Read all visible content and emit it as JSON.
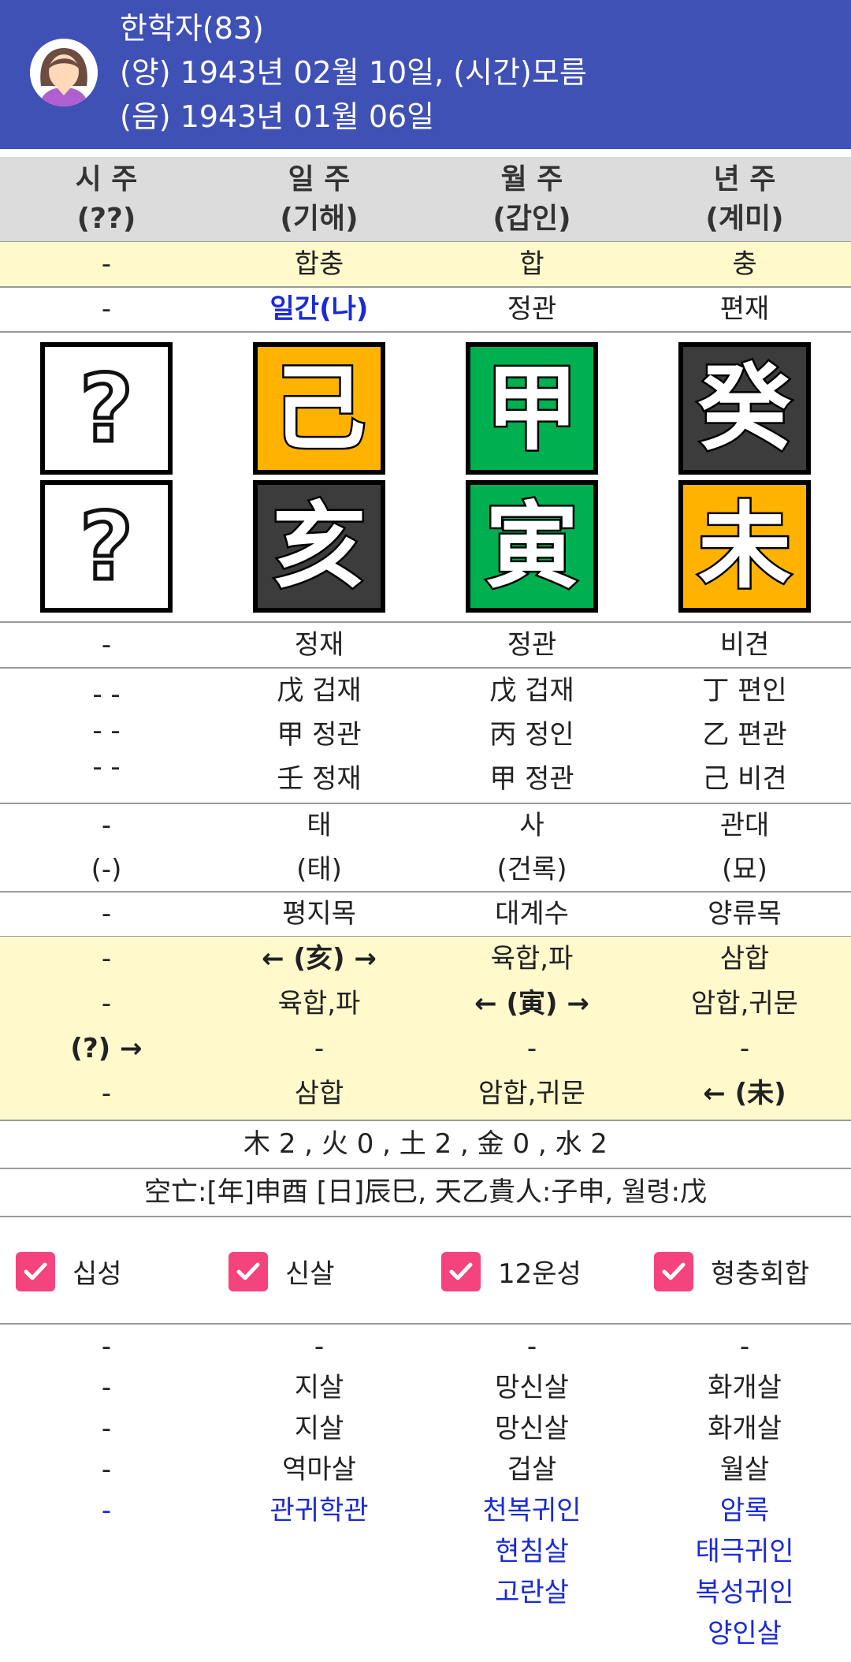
{
  "profile": {
    "name": "한학자(83)",
    "solar": "(양) 1943년 02월 10일, (시간)모름",
    "lunar": "(음) 1943년 01월 06일"
  },
  "pillars": [
    {
      "label": "시 주",
      "ganji": "(??)"
    },
    {
      "label": "일 주",
      "ganji": "(기해)"
    },
    {
      "label": "월 주",
      "ganji": "(갑인)"
    },
    {
      "label": "년 주",
      "ganji": "(계미)"
    }
  ],
  "relations": [
    "-",
    "합충",
    "합",
    "충"
  ],
  "stem_sipsung": [
    "-",
    "일간(나)",
    "정관",
    "편재"
  ],
  "stems": [
    {
      "char": "?",
      "color": "white"
    },
    {
      "char": "己",
      "color": "yellow"
    },
    {
      "char": "甲",
      "color": "green"
    },
    {
      "char": "癸",
      "color": "dark"
    }
  ],
  "branches": [
    {
      "char": "?",
      "color": "white"
    },
    {
      "char": "亥",
      "color": "dark"
    },
    {
      "char": "寅",
      "color": "green"
    },
    {
      "char": "未",
      "color": "yellow"
    }
  ],
  "branch_sipsung": [
    "-",
    "정재",
    "정관",
    "비견"
  ],
  "hidden_stems": [
    [
      "- -",
      "- -",
      "- -"
    ],
    [
      "戊 겁재",
      "甲 정관",
      "壬 정재"
    ],
    [
      "戊 겁재",
      "丙 정인",
      "甲 정관"
    ],
    [
      "丁 편인",
      "乙 편관",
      "己 비견"
    ]
  ],
  "unsung": [
    [
      "-",
      "(-)"
    ],
    [
      "태",
      "(태)"
    ],
    [
      "사",
      "(건록)"
    ],
    [
      "관대",
      "(묘)"
    ]
  ],
  "napeum": [
    "-",
    "평지목",
    "대계수",
    "양류목"
  ],
  "hyungchung": [
    [
      "-",
      "← (亥) →",
      "육합,파",
      "삼합"
    ],
    [
      "-",
      "육합,파",
      "← (寅) →",
      "암합,귀문"
    ],
    [
      "(?) →",
      "-",
      "-",
      "-"
    ],
    [
      "-",
      "삼합",
      "암합,귀문",
      "← (未)"
    ]
  ],
  "elements": "木 2 , 火 0 , 土 2 , 金 0 , 水 2",
  "gongmang": "空亡:[年]申酉 [日]辰巳, 天乙貴人:子申, 월령:戊",
  "checks": [
    "십성",
    "신살",
    "12운성",
    "형충회합"
  ],
  "sinsal": [
    {
      "black": [
        "-",
        "-",
        "-",
        "-"
      ],
      "blue": [
        "-"
      ]
    },
    {
      "black": [
        "-",
        "지살",
        "지살",
        "역마살"
      ],
      "blue": [
        "관귀학관"
      ]
    },
    {
      "black": [
        "-",
        "망신살",
        "망신살",
        "겁살"
      ],
      "blue": [
        "천복귀인",
        "현침살",
        "고란살"
      ]
    },
    {
      "black": [
        "-",
        "화개살",
        "화개살",
        "월살"
      ],
      "blue": [
        "암록",
        "태극귀인",
        "복성귀인",
        "양인살"
      ]
    }
  ],
  "colors": {
    "header_bg": "#3f51b5",
    "yellow_stem": "#ffb300",
    "green_stem": "#00b050",
    "dark_stem": "#3c3c3c",
    "checkbox": "#f5437d",
    "highlight_bg": "#fff9cc",
    "blue_text": "#1a2bd6"
  }
}
